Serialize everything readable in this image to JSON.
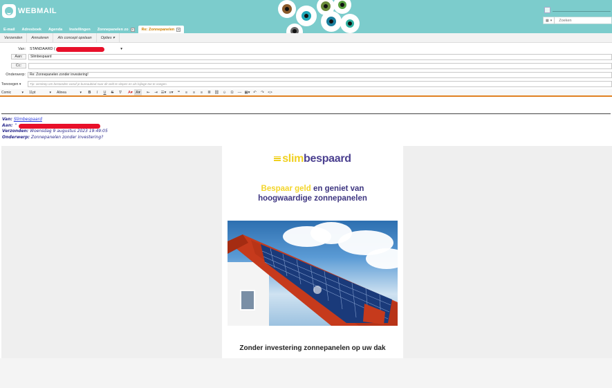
{
  "header": {
    "app_name": "WEBMAIL",
    "search_placeholder": "Zoeken",
    "search_scope": "▾"
  },
  "tabs": [
    {
      "label": "E-mail"
    },
    {
      "label": "Adresboek"
    },
    {
      "label": "Agenda"
    },
    {
      "label": "Instellingen"
    },
    {
      "label": "Zonnepanelen zo"
    },
    {
      "label": "Re: Zonnepanelen"
    }
  ],
  "actions": [
    {
      "label": "Verzenden"
    },
    {
      "label": "Annuleren"
    },
    {
      "label": "Als concept opslaan"
    },
    {
      "label": "Opties ▾"
    }
  ],
  "compose": {
    "from_label": "Van:",
    "from_value": "STANDAARD (",
    "to_label": "Aan:",
    "to_value": "Slimbespaard",
    "cc_label": "Cc:",
    "cc_value": "",
    "subject_label": "Onderwerp:",
    "subject_value": "Re: Zonnepanelen zonder investering!",
    "attach_label": "Toevoegen ▾",
    "attach_hint": "Tip: versleep om bestanden vanaf je bureaublad naar dit veld te slepen en als bijlage toe te voegen."
  },
  "toolbar": {
    "font_family": "Comic",
    "font_size": "11pt",
    "style": "Alinea"
  },
  "quote": {
    "from_label": "Van:",
    "from_value": "Slimbespaard",
    "to_label": "Aan:",
    "to_value": "\"",
    "sent_label": "Verzonden:",
    "sent_value": "Woensdag 9 augustus 2023 19:49:05",
    "subject_label": "Onderwerp:",
    "subject_value": "Zonnepanelen zonder investering?"
  },
  "email": {
    "brand_slim": "slim",
    "brand_bespaard": "bespaard",
    "headline_accent": "Bespaar geld",
    "headline_rest": " en geniet van",
    "headline_line2": "hoogwaardige zonnepanelen",
    "subhead": "Zonder investering zonnepanelen op uw dak"
  }
}
